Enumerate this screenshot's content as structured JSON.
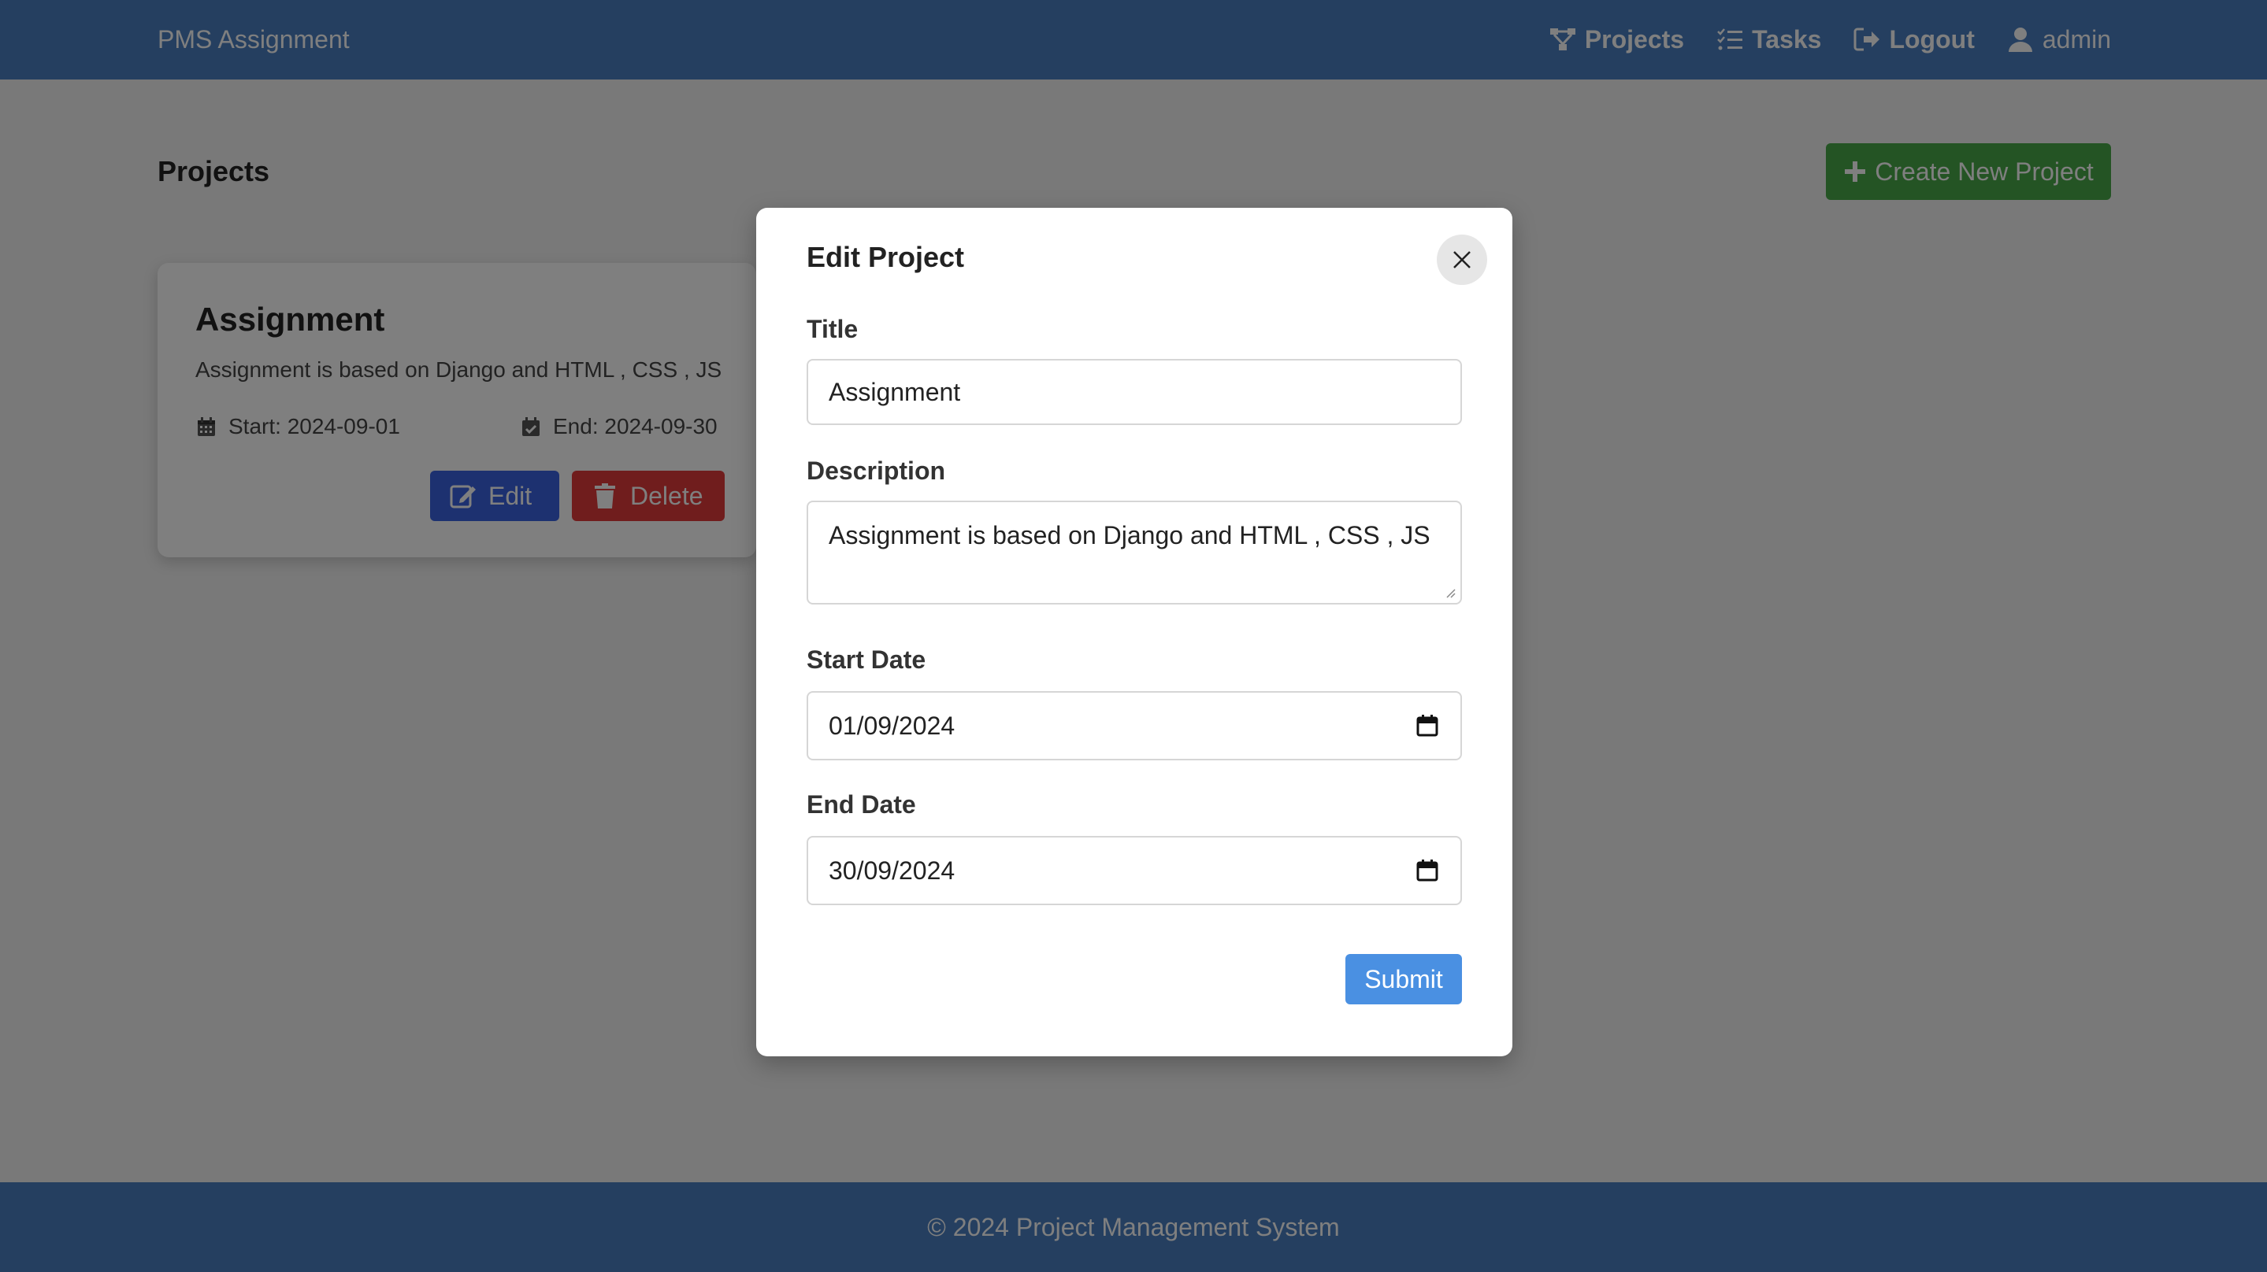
{
  "navbar": {
    "brand": "PMS Assignment",
    "links": [
      {
        "label": "Projects",
        "icon": "sitemap-icon"
      },
      {
        "label": "Tasks",
        "icon": "tasks-list-icon"
      },
      {
        "label": "Logout",
        "icon": "logout-icon"
      },
      {
        "label": "admin",
        "icon": "user-icon"
      }
    ]
  },
  "main": {
    "title": "Projects",
    "create_button": "Create New Project"
  },
  "project_card": {
    "title": "Assignment",
    "description": "Assignment is based on Django and HTML , CSS , JS",
    "start": "Start: 2024-09-01",
    "end": "End: 2024-09-30",
    "edit_label": "Edit",
    "delete_label": "Delete"
  },
  "modal": {
    "title": "Edit Project",
    "fields": {
      "title_label": "Title",
      "title_value": "Assignment",
      "description_label": "Description",
      "description_value": "Assignment is based on Django and HTML , CSS , JS",
      "start_label": "Start Date",
      "start_value": "01/09/2024",
      "end_label": "End Date",
      "end_value": "30/09/2024"
    },
    "submit_label": "Submit"
  },
  "footer": {
    "text": "© 2024 Project Management System"
  },
  "colors": {
    "navbar": "#4a7fc0",
    "create_button": "#48a948",
    "edit_button": "#3a63e0",
    "delete_button": "#e03a3a",
    "submit_button": "#4a90e2"
  }
}
